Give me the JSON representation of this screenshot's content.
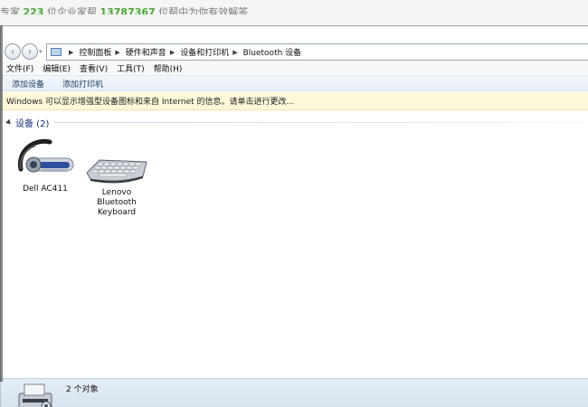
{
  "background_page": {
    "text_prefix": "专家",
    "num1": "223",
    "text_mid": "位企业家帮",
    "num2": "13787367",
    "text_suffix": "位帮中为你有效解答"
  },
  "address_bar": {
    "breadcrumbs": [
      "控制面板",
      "硬件和声音",
      "设备和打印机",
      "Bluetooth 设备"
    ]
  },
  "menu": {
    "items": [
      "文件(F)",
      "编辑(E)",
      "查看(V)",
      "工具(T)",
      "帮助(H)"
    ]
  },
  "commands": {
    "add_device": "添加设备",
    "add_printer": "添加打印机"
  },
  "infobar": {
    "text": "Windows 可以显示增强型设备图标和来自 Internet 的信息。请单击进行更改..."
  },
  "group": {
    "title": "设备 (2)"
  },
  "devices": [
    {
      "label": "Dell AC411",
      "icon": "headset-icon"
    },
    {
      "label": "Lenovo Bluetooth Keyboard",
      "icon": "keyboard-icon"
    }
  ],
  "status": {
    "count": "2 个对象",
    "icon": "printer-icon"
  },
  "colors": {
    "accent_blue": "#1e3287",
    "infobar_bg": "#fdf8d9",
    "status_bg": "#d7e3f0",
    "bg_number_green": "#4aa53a"
  }
}
